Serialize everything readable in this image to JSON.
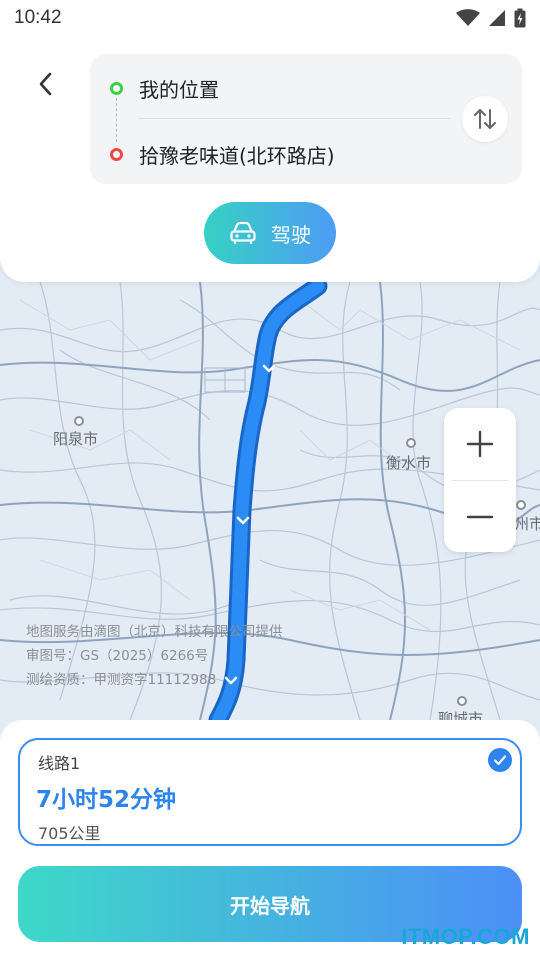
{
  "status_bar": {
    "time": "10:42"
  },
  "route": {
    "start": "我的位置",
    "end": "拾豫老味道(北环路店)"
  },
  "mode": {
    "label": "驾驶"
  },
  "map": {
    "cities": [
      "阳泉市",
      "衡水市",
      "州市",
      "聊城市"
    ],
    "attribution": [
      "地图服务由滴图（北京）科技有限公司提供",
      "审图号：GS（2025）6266号",
      "测绘资质：甲测资字11112988"
    ],
    "colors": {
      "route": "#1f7df2",
      "route_outline": "#1866c8",
      "road": "#9fb2c8",
      "background": "#e3ebf5"
    }
  },
  "zoom": {
    "in_label": "+",
    "out_label": "−"
  },
  "result": {
    "route_name": "线路1",
    "duration": "7小时52分钟",
    "distance": "705公里",
    "selected": true
  },
  "navigation": {
    "button_label": "开始导航"
  },
  "watermark": "ITMOP.COM",
  "colors": {
    "accent": "#2e84ee",
    "gradient_start": "#3ed8c8",
    "gradient_end": "#4c8ff7"
  }
}
